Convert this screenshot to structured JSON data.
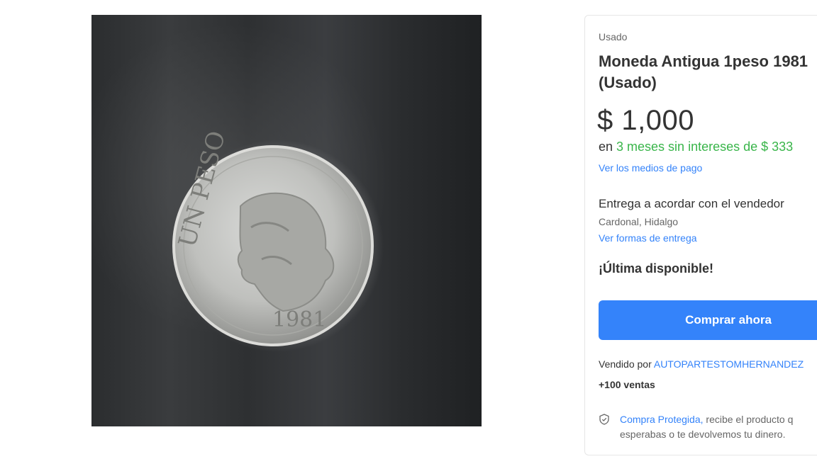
{
  "product": {
    "condition": "Usado",
    "title_line1": "Moneda Antigua 1peso 1981",
    "title_line2": "(Usado)",
    "price": "$ 1,000",
    "installments_prefix": "en ",
    "installments_highlight": "3 meses sin intereses de $ 333",
    "payment_link": "Ver los medios de pago",
    "delivery": "Entrega a acordar con el vendedor",
    "location": "Cardonal, Hidalgo",
    "delivery_link": "Ver formas de entrega",
    "stock": "¡Última disponible!",
    "buy_button": "Comprar ahora",
    "seller_prefix": "Vendido por ",
    "seller_name": "AUTOPARTESTOMHERNANDEZ",
    "sales": "+100 ventas",
    "protection_link": "Compra Protegida,",
    "protection_text_1": " recibe el producto q",
    "protection_text_2": "esperabas o te devolvemos tu dinero."
  },
  "coin": {
    "legend": "UN PESO",
    "year": "1981"
  },
  "colors": {
    "accent": "#3483fa",
    "installments": "#39b54a"
  }
}
